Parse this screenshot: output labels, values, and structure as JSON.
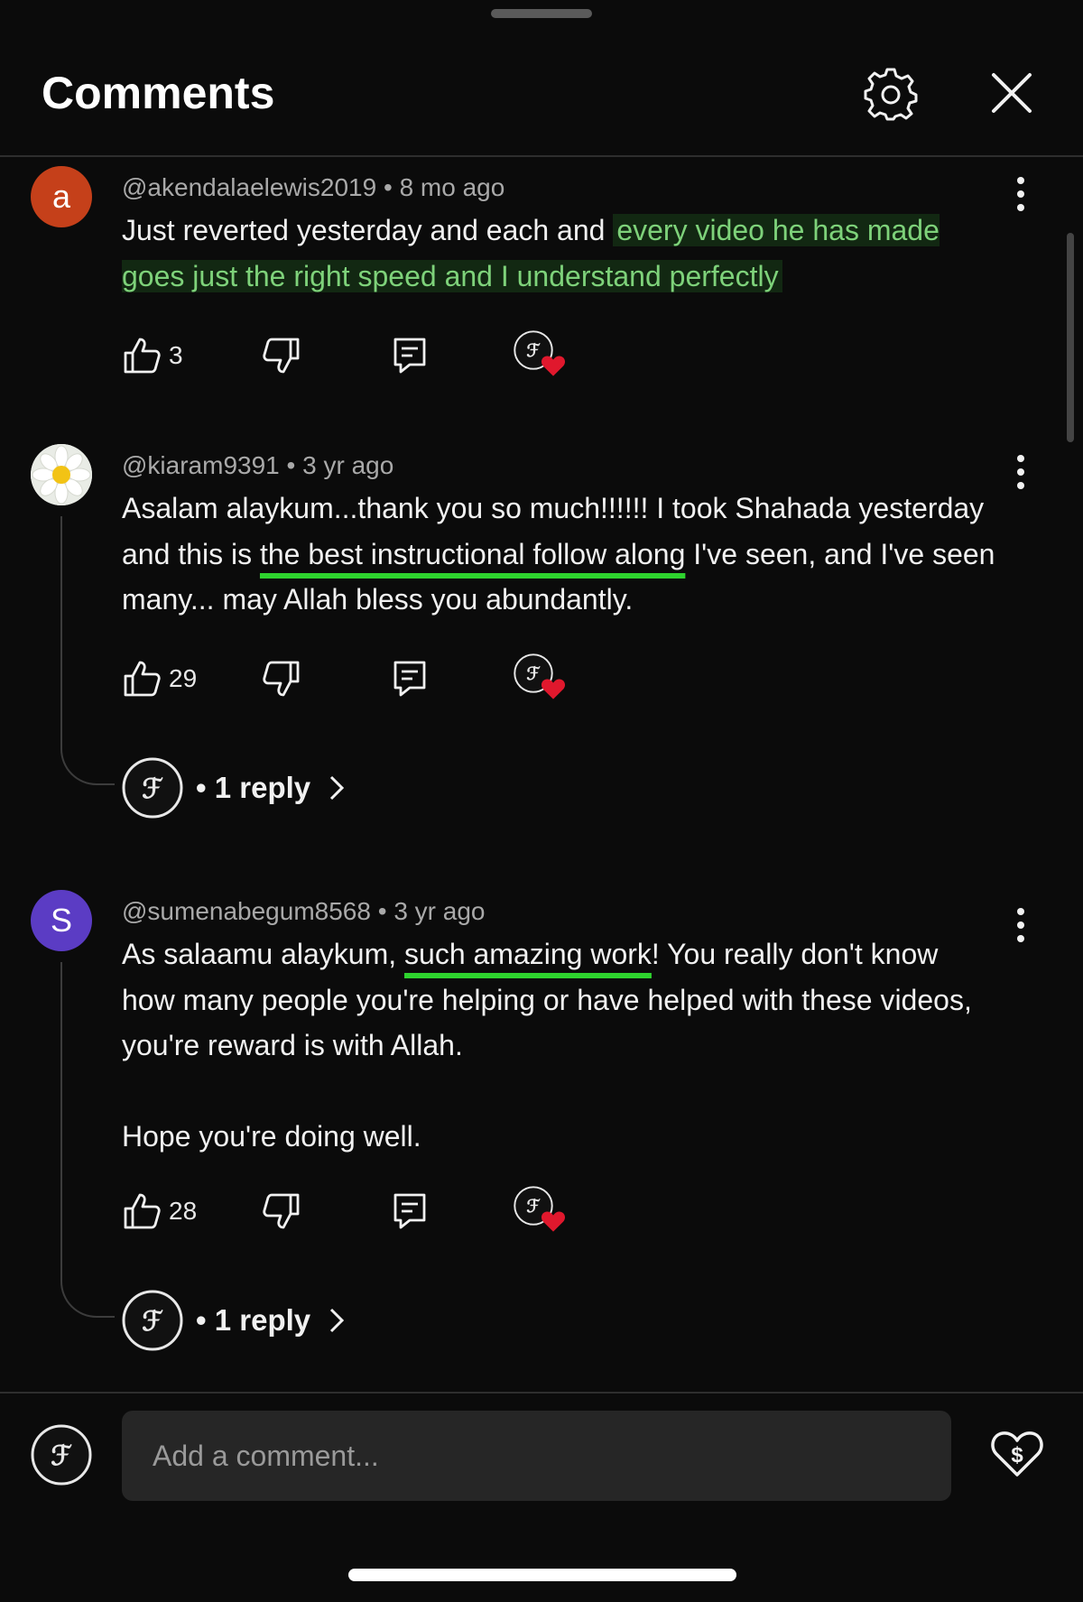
{
  "header": {
    "title": "Comments",
    "settings_icon": "gear-icon",
    "close_icon": "close-icon"
  },
  "comments": [
    {
      "author": "@akendalaelewis2019",
      "time": "8 mo ago",
      "avatar_letter": "a",
      "avatar_color": "#c5401a",
      "text_before": "Just reverted yesterday and each and ",
      "text_highlight": "every video he has made goes just the right speed and I understand perfectly",
      "likes": "3"
    },
    {
      "author": "@kiaram9391",
      "time": "3 yr ago",
      "avatar_letter": "",
      "text_before": "Asalam alaykum...thank you so much!!!!!! I took Shahada yesterday and this is ",
      "text_highlight": "the best instructional follow along",
      "text_after": " I've seen, and I've seen many... may Allah bless you abundantly.",
      "likes": "29",
      "replies": "1 reply"
    },
    {
      "author": "@sumenabegum8568",
      "time": "3 yr ago",
      "avatar_letter": "S",
      "avatar_color": "#5b3cc4",
      "text_before": "As salaamu alaykum, ",
      "text_highlight": "such amazing work",
      "text_after": "! You really don't know how many people you're helping or have helped with these videos, you're reward is with Allah.\n\nHope you're doing well.",
      "likes": "28",
      "replies": "1 reply"
    }
  ],
  "footer": {
    "input_placeholder": "Add a comment...",
    "thanks_icon": "super-thanks-icon"
  },
  "colors": {
    "background": "#0b0b0b",
    "highlight_green": "#7ed27a",
    "underline_green": "#2ed32e",
    "heart_red": "#e0182d"
  }
}
